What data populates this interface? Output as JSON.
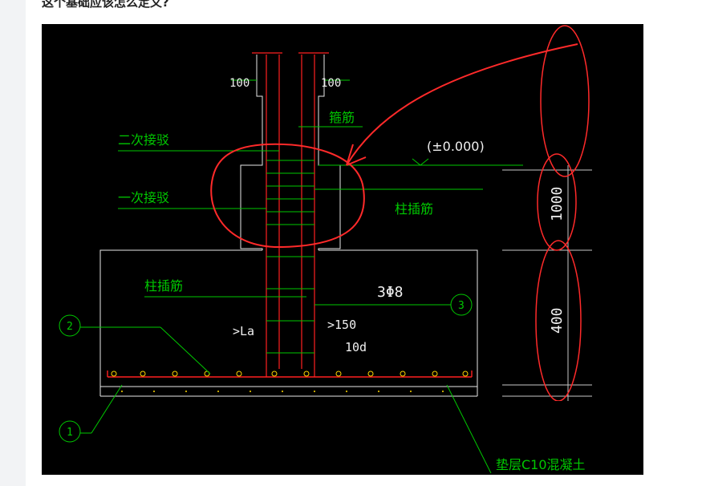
{
  "post": {
    "title": "这个基础应该怎么定义?"
  },
  "drawing": {
    "dim_left": "100",
    "dim_right": "100",
    "label_stirrup": "箍筋",
    "label_second_splice": "二次接驳",
    "label_first_splice": "一次接驳",
    "label_elevation": "(±0.000)",
    "label_column_dowel_right": "柱插筋",
    "label_column_dowel_left": "柱插筋",
    "label_rebar": "3Φ8",
    "label_la": ">La",
    "label_150": ">150",
    "label_10d": "10d",
    "callout_1": "1",
    "callout_2": "2",
    "callout_3": "3",
    "label_cushion": "垫层C10混凝土",
    "colors": {
      "background": "#000000",
      "lines": "#00c800",
      "rebar": "#ff2020",
      "markup": "#ff2a2a",
      "text": "#f0f0f0"
    }
  },
  "dimensions": {
    "dim_1000": "1000",
    "dim_400": "400",
    "dim_100": "100"
  }
}
